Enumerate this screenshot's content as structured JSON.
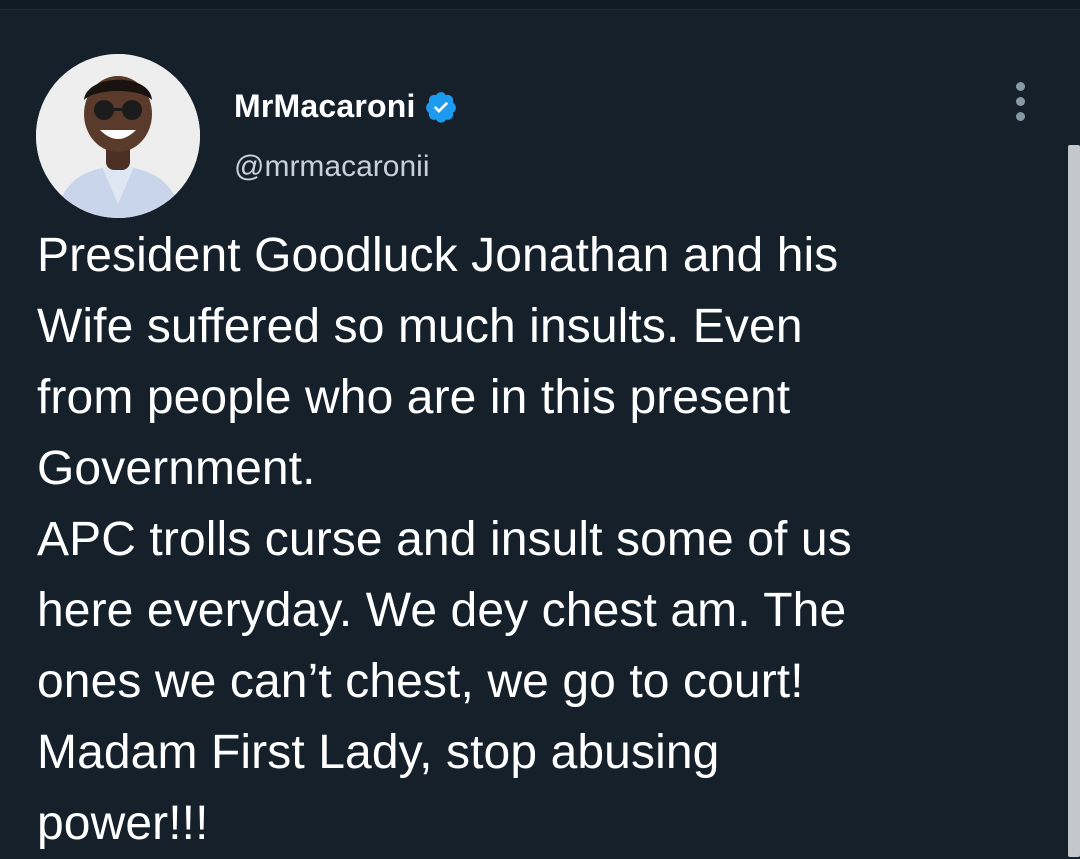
{
  "tweet": {
    "display_name": "MrMacaroni",
    "handle": "@mrmacaronii",
    "verified": true,
    "text": "President Goodluck Jonathan and his\nWife suffered so much insults. Even\nfrom people who are in this present\nGovernment.\nAPC trolls curse and insult some of us\nhere everyday. We dey chest am. The\nones we can’t chest, we go to court!\nMadam First Lady, stop abusing\npower!!!"
  },
  "icons": {
    "verified": "verified-badge-icon",
    "more": "more-options-icon"
  },
  "colors": {
    "background": "#15202b",
    "verified": "#1d9bf0",
    "text": "#ffffff",
    "secondary_text": "#c9d1d8"
  }
}
